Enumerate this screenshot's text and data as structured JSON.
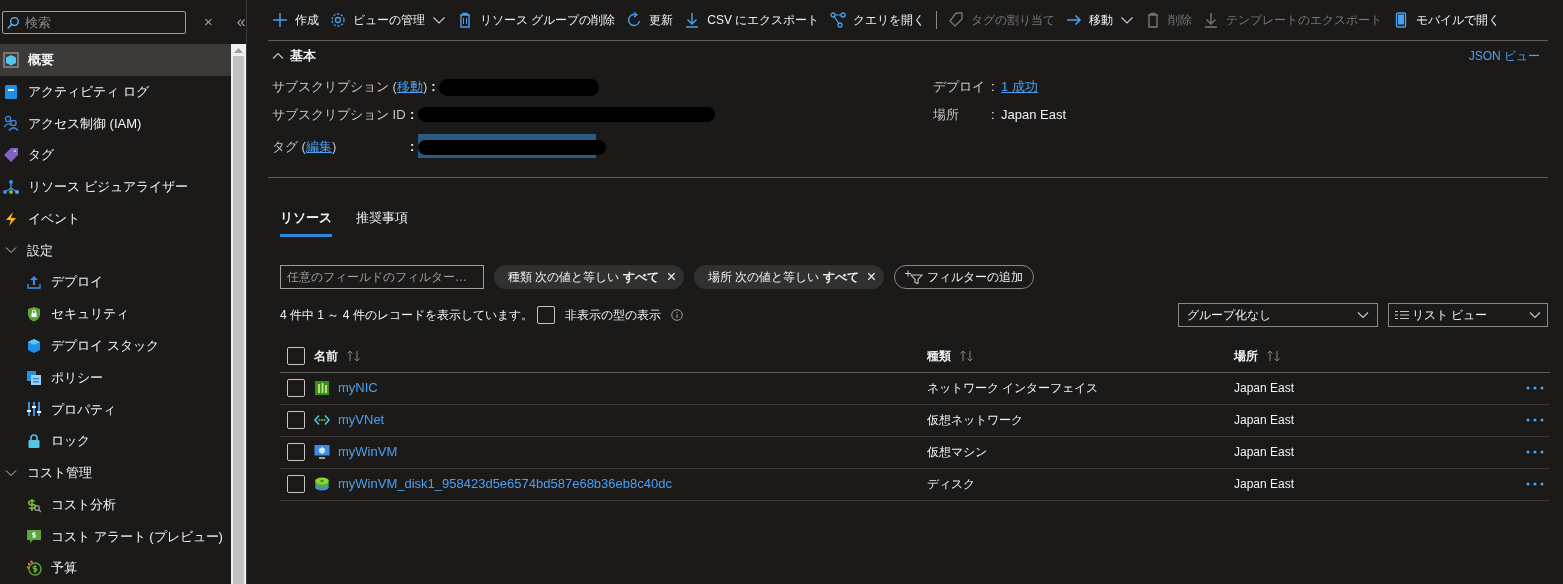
{
  "sidebar": {
    "search": {
      "placeholder": "検索"
    },
    "close_glyph": "×",
    "collapse_glyph": "«",
    "items": [
      {
        "kind": "item",
        "label": "概要",
        "selected": true
      },
      {
        "kind": "item",
        "label": "アクティビティ ログ",
        "selected": false
      },
      {
        "kind": "item",
        "label": "アクセス制御 (IAM)",
        "selected": false
      },
      {
        "kind": "item",
        "label": "タグ",
        "selected": false
      },
      {
        "kind": "item",
        "label": "リソース ビジュアライザー",
        "selected": false
      },
      {
        "kind": "item",
        "label": "イベント",
        "selected": false
      },
      {
        "kind": "group",
        "label": "設定",
        "expanded": true,
        "children": [
          {
            "label": "デプロイ",
            "selected": false
          },
          {
            "label": "セキュリティ",
            "selected": false
          },
          {
            "label": "デプロイ スタック",
            "selected": false
          },
          {
            "label": "ポリシー",
            "selected": false
          },
          {
            "label": "プロパティ",
            "selected": false
          },
          {
            "label": "ロック",
            "selected": false
          }
        ]
      },
      {
        "kind": "group",
        "label": "コスト管理",
        "expanded": true,
        "children": [
          {
            "label": "コスト分析",
            "selected": false
          },
          {
            "label": "コスト アラート (プレビュー)",
            "selected": false
          },
          {
            "label": "予算",
            "selected": false
          }
        ]
      }
    ]
  },
  "toolbar": [
    {
      "kind": "button",
      "label": "作成",
      "disabled": false,
      "dropdown": false
    },
    {
      "kind": "button",
      "label": "ビューの管理",
      "disabled": false,
      "dropdown": true
    },
    {
      "kind": "button",
      "label": "リソース グループの削除",
      "disabled": false,
      "dropdown": false
    },
    {
      "kind": "button",
      "label": "更新",
      "disabled": false,
      "dropdown": false
    },
    {
      "kind": "button",
      "label": "CSV にエクスポート",
      "disabled": false,
      "dropdown": false
    },
    {
      "kind": "button",
      "label": "クエリを開く",
      "disabled": false,
      "dropdown": false
    },
    {
      "kind": "separator"
    },
    {
      "kind": "button",
      "label": "タグの割り当て",
      "disabled": true,
      "dropdown": false
    },
    {
      "kind": "button",
      "label": "移動",
      "disabled": false,
      "dropdown": true
    },
    {
      "kind": "button",
      "label": "削除",
      "disabled": true,
      "dropdown": false
    },
    {
      "kind": "button",
      "label": "テンプレートのエクスポート",
      "disabled": true,
      "dropdown": false
    },
    {
      "kind": "button",
      "label": "モバイルで開く",
      "disabled": false,
      "dropdown": false
    }
  ],
  "essentials": {
    "title": "基本",
    "expanded": true,
    "json_view": "JSON ビュー",
    "left": [
      {
        "label_prefix": "サブスクリプション (",
        "link": "移動",
        "label_suffix": ")",
        "separator": ":",
        "redacted": true
      },
      {
        "label_prefix": "サブスクリプション ID",
        "separator": ":",
        "redacted": true
      },
      {
        "label_prefix": "タグ (",
        "link": "編集",
        "label_suffix": ")",
        "separator": ":",
        "redacted": true
      }
    ],
    "right": [
      {
        "label": "デプロイ",
        "separator": ":",
        "value": "1 成功",
        "value_is_link": true
      },
      {
        "label": "場所",
        "separator": ":",
        "value": "Japan East",
        "value_is_link": false
      }
    ]
  },
  "tabs": [
    {
      "label": "リソース",
      "selected": true
    },
    {
      "label": "推奨事項",
      "selected": false
    }
  ],
  "filter": {
    "placeholder": "任意のフィールドのフィルター…",
    "pills": [
      {
        "field": "種類",
        "op": "次の値と等しい",
        "value": "すべて",
        "remove_glyph": "×"
      },
      {
        "field": "場所",
        "op": "次の値と等しい",
        "value": "すべて",
        "remove_glyph": "×"
      }
    ],
    "add_filter": "フィルターの追加"
  },
  "record_count": "4 件中 1 ～ 4 件のレコードを表示しています。",
  "show_hidden": {
    "label": "非表示の型の表示",
    "checked": false
  },
  "group_by": "グループ化なし",
  "view": "リスト ビュー",
  "table": {
    "columns": [
      "名前",
      "種類",
      "場所"
    ],
    "all_checked": false,
    "rows": [
      {
        "name": "myNIC",
        "type": "ネットワーク インターフェイス",
        "location": "Japan East",
        "checked": false
      },
      {
        "name": "myVNet",
        "type": "仮想ネットワーク",
        "location": "Japan East",
        "checked": false
      },
      {
        "name": "myWinVM",
        "type": "仮想マシン",
        "location": "Japan East",
        "checked": false
      },
      {
        "name": "myWinVM_disk1_958423d5e6574bd587e68b36eb8c40dc",
        "type": "ディスク",
        "location": "Japan East",
        "checked": false
      }
    ]
  }
}
